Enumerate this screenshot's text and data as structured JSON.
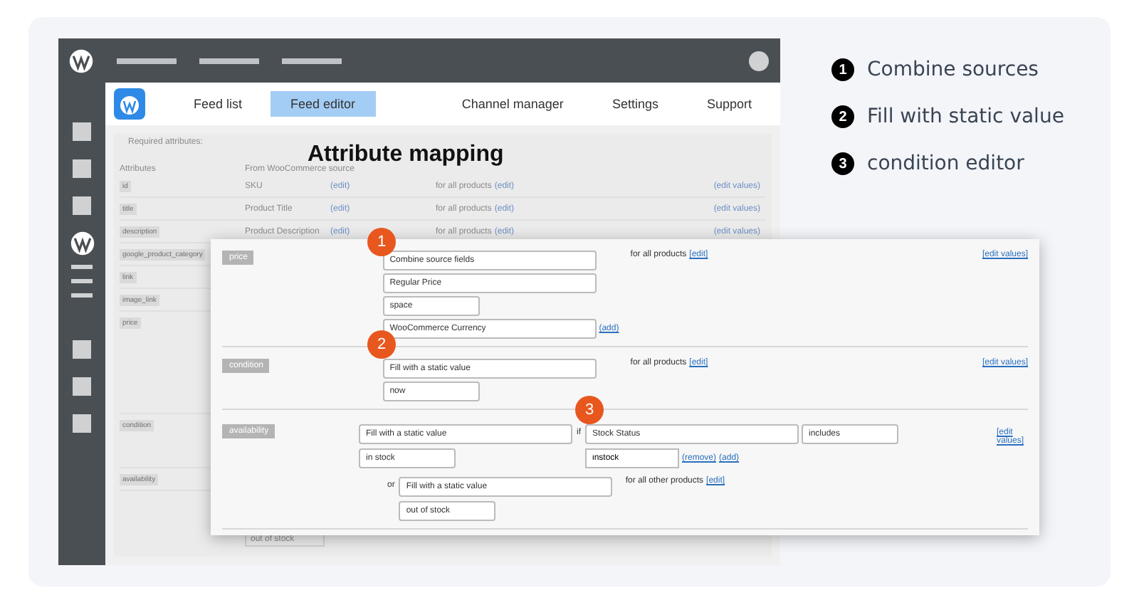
{
  "plugin_nav": {
    "tabs": [
      {
        "label": "Feed list",
        "selected": false
      },
      {
        "label": "Feed editor",
        "selected": true
      },
      {
        "label": "Channel manager",
        "selected": false
      },
      {
        "label": "Settings",
        "selected": false
      },
      {
        "label": "Support",
        "selected": false
      }
    ]
  },
  "heading": "Attribute mapping",
  "background_table": {
    "section": "Required attributes:",
    "columns": [
      "Attributes",
      "From WooCommerce source"
    ],
    "rows": [
      {
        "attribute": "id",
        "source": "SKU",
        "source_link": "(edit)",
        "condition": "for all products",
        "condition_link": "(edit)",
        "values_link": "(edit values)"
      },
      {
        "attribute": "title",
        "source": "Product Title",
        "source_link": "(edit)",
        "condition": "for all products",
        "condition_link": "(edit)",
        "values_link": "(edit values)"
      },
      {
        "attribute": "description",
        "source": "Product Description",
        "source_link": "(edit)",
        "condition": "for all products",
        "condition_link": "(edit)",
        "values_link": "(edit values)"
      },
      {
        "attribute": "google_product_category"
      },
      {
        "attribute": "link"
      },
      {
        "attribute": "image_link"
      },
      {
        "attribute": "price"
      },
      {
        "attribute": "condition"
      },
      {
        "attribute": "availability"
      }
    ],
    "footer_select": "out of stock"
  },
  "mapping": [
    {
      "kind": "combine",
      "attribute": "price",
      "badge": "1",
      "selects": [
        {
          "value": "Combine source fields",
          "kind": "wide"
        },
        {
          "value": "Regular Price",
          "kind": "wide"
        },
        {
          "value": "space",
          "kind": "short"
        },
        {
          "value": "WooCommerce Currency",
          "kind": "wide"
        }
      ],
      "add_link": "(add)",
      "condition": "for all products",
      "condition_link": "[edit]",
      "values_link": "[edit values]"
    },
    {
      "kind": "static",
      "attribute": "condition",
      "badge": "2",
      "selects": [
        {
          "value": "Fill with a static value",
          "kind": "wide"
        },
        {
          "value": "now",
          "kind": "short"
        }
      ],
      "condition": "for all products",
      "condition_link": "[edit]",
      "values_link": "[edit values]"
    },
    {
      "kind": "conditional",
      "attribute": "availability",
      "badge": "3",
      "selects": [
        {
          "value": "Fill with a static value",
          "kind": "wide"
        },
        {
          "value": "in stock",
          "kind": "short"
        }
      ],
      "if_label": "if",
      "if_field": {
        "value": "Stock Status",
        "kind": "wide"
      },
      "operator": {
        "value": "includes",
        "kind": "short"
      },
      "match_value": "instock",
      "remove_link": "(remove)",
      "add_link": "(add)",
      "else_label": "or",
      "else_selects": [
        {
          "value": "Fill with a static value",
          "kind": "wide"
        },
        {
          "value": "out of stock",
          "kind": "short"
        }
      ],
      "else_condition": "for all other products",
      "else_condition_link": "[edit]",
      "values_link": "[edit values]"
    }
  ],
  "legend": [
    {
      "number": "1",
      "label": "Combine sources"
    },
    {
      "number": "2",
      "label": "Fill with static value"
    },
    {
      "number": "3",
      "label": "condition editor"
    }
  ]
}
